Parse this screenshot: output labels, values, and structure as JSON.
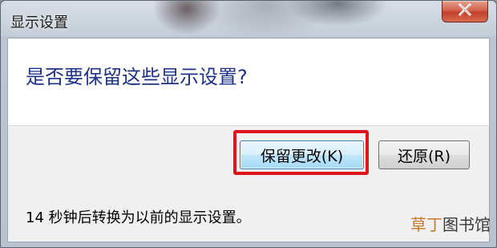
{
  "window": {
    "title": "显示设置",
    "close_icon": "close-icon"
  },
  "dialog": {
    "question": "是否要保留这些显示设置?",
    "keep_button": "保留更改(K)",
    "revert_button": "还原(R)",
    "countdown": "14 秒钟后转换为以前的显示设置。"
  },
  "highlight_color": "#e0141c",
  "watermark": {
    "part1": "草丁",
    "part2": "图书馆"
  }
}
